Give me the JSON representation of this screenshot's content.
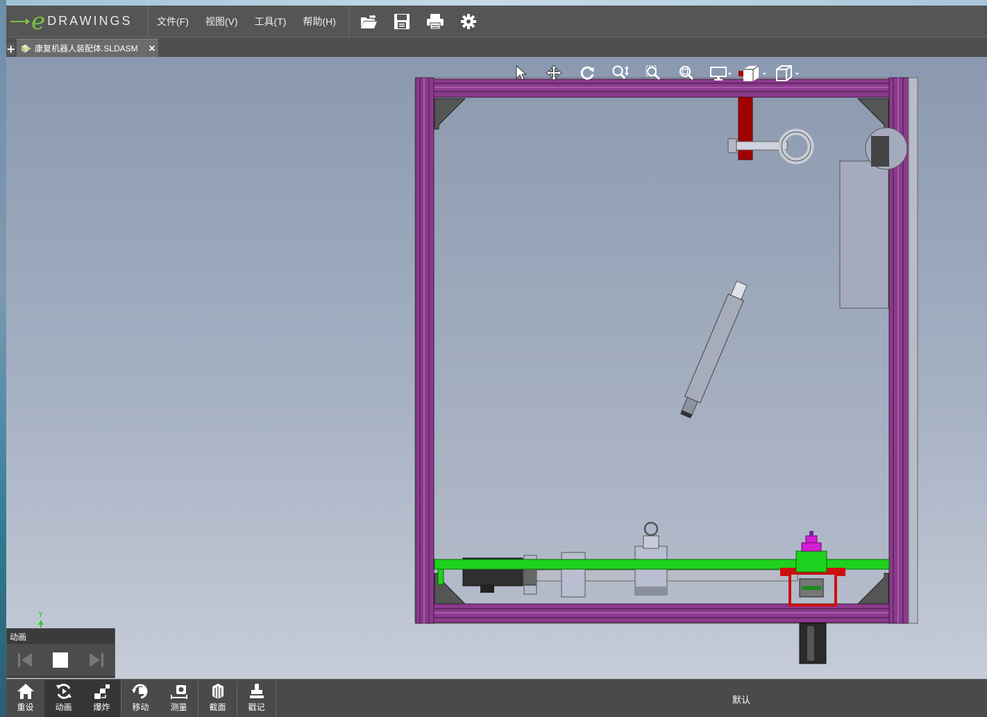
{
  "app": {
    "logo_text": "DRAWINGS",
    "brand_color": "#7fc241"
  },
  "menu": {
    "file": "文件(F)",
    "view": "视图(V)",
    "tools": "工具(T)",
    "help": "帮助(H)"
  },
  "toolbar_icons": [
    "open-icon",
    "save-icon",
    "print-icon",
    "settings-icon"
  ],
  "tab": {
    "label": "康复机器人装配体.SLDASM",
    "close": "×",
    "new_tab": "+"
  },
  "viewport_icons": [
    "select-icon",
    "pan-icon",
    "rotate-icon",
    "zoom-icon",
    "zoom-to-area-icon",
    "zoom-to-fit-icon",
    "display-icon",
    "view-orientation-icon",
    "standard-views-icon"
  ],
  "triad": {
    "y_label": "Y"
  },
  "animation": {
    "title": "动画"
  },
  "bottom_tools": [
    {
      "label": "重设",
      "icon": "home-icon"
    },
    {
      "label": "动画",
      "icon": "animation-icon"
    },
    {
      "label": "爆炸",
      "icon": "explode-icon"
    },
    {
      "label": "移动",
      "icon": "move-icon"
    },
    {
      "label": "测量",
      "icon": "measure-icon"
    },
    {
      "label": "截面",
      "icon": "section-icon"
    },
    {
      "label": "戳记",
      "icon": "stamp-icon"
    }
  ],
  "configuration": "默认",
  "colors": {
    "frame": "#8b3a8e",
    "base_plate": "#1fd11f",
    "arm": "#a00000",
    "bracket": "#cc1010",
    "pulley": "#d21fd2"
  }
}
